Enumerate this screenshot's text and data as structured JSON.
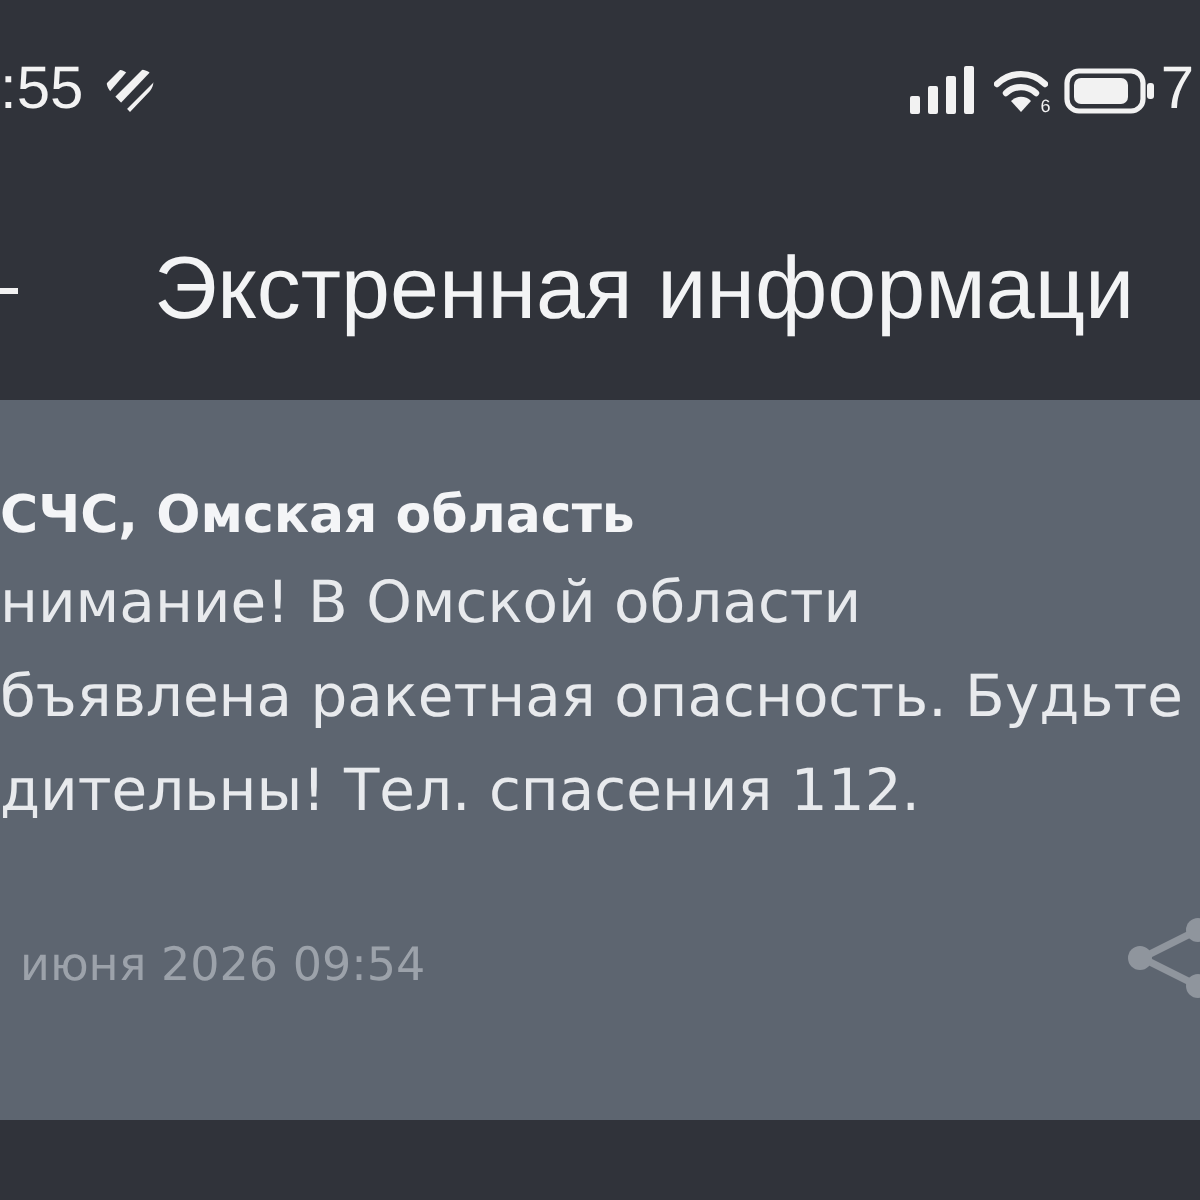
{
  "status_bar": {
    "time": ":55",
    "wifi_badge": "6",
    "battery_percent": "7"
  },
  "header": {
    "title": "Экстренная информаци"
  },
  "alert": {
    "sender": "СЧС, Омская область",
    "message_lines": [
      "нимание! В Омской области",
      "бъявлена ракетная опасность. Будьте",
      "дительны! Тел. спасения 112."
    ],
    "timestamp": "июня 2026 09:54"
  }
}
